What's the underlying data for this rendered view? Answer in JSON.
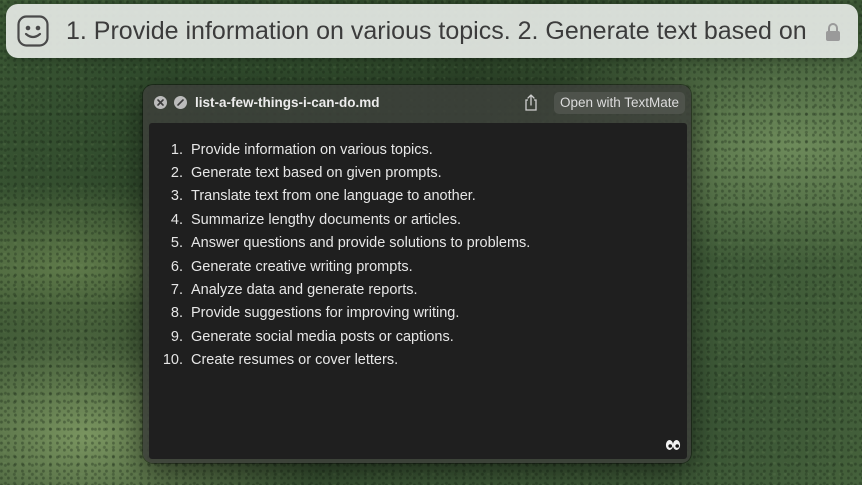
{
  "spotlight": {
    "query": "1. Provide information on various topics. 2. Generate text based on...",
    "app_icon": "smiley-face-icon",
    "lock_icon": "lock-icon"
  },
  "window": {
    "filename": "list-a-few-things-i-can-do.md",
    "open_button_label": "Open with TextMate",
    "icons": [
      "close-icon",
      "disable-icon",
      "share-icon",
      "eyes-icon"
    ],
    "items": [
      {
        "num": "1.",
        "text": "Provide information on various topics."
      },
      {
        "num": "2.",
        "text": "Generate text based on given prompts."
      },
      {
        "num": "3.",
        "text": "Translate text from one language to another."
      },
      {
        "num": "4.",
        "text": "Summarize lengthy documents or articles."
      },
      {
        "num": "5.",
        "text": "Answer questions and provide solutions to problems."
      },
      {
        "num": "6.",
        "text": "Generate creative writing prompts."
      },
      {
        "num": "7.",
        "text": "Analyze data and generate reports."
      },
      {
        "num": "8.",
        "text": "Provide suggestions for improving writing."
      },
      {
        "num": "9.",
        "text": "Generate social media posts or captions."
      },
      {
        "num": "10.",
        "text": "Create resumes or cover letters."
      }
    ]
  }
}
